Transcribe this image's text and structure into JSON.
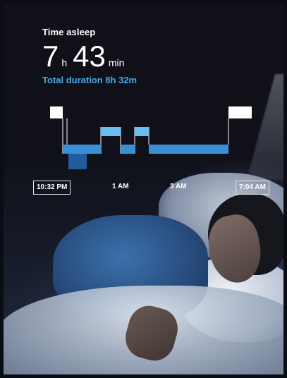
{
  "title": "Time asleep",
  "time_asleep": {
    "hours": "7",
    "hours_unit": "h",
    "minutes": "43",
    "minutes_unit": "min"
  },
  "total_duration": "Total duration 8h 32m",
  "time_axis": {
    "start": "10:32 PM",
    "tick_1": "1 AM",
    "tick_2": "3 AM",
    "end": "7:04 AM"
  },
  "colors": {
    "awake": "#ffffff",
    "rem": "#66bff0",
    "light": "#3a8fd6",
    "deep": "#1f5d9c",
    "accent_text": "#4aa8e8"
  }
}
